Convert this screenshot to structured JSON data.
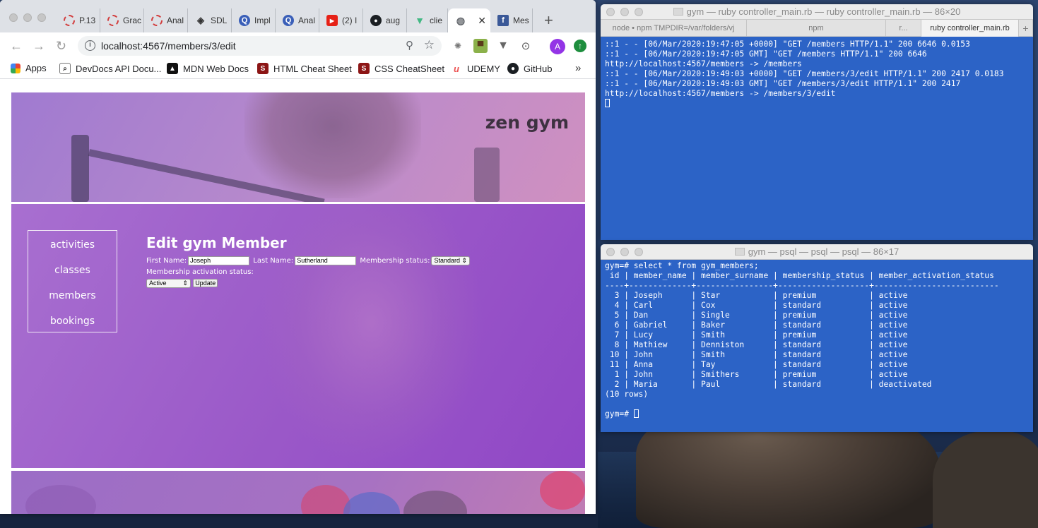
{
  "browser": {
    "tabs": [
      {
        "label": "P.13",
        "icon": "red-ring-icon"
      },
      {
        "label": "Grac",
        "icon": "red-ring-icon"
      },
      {
        "label": "Anal",
        "icon": "red-ring-icon"
      },
      {
        "label": "SDL",
        "icon": "diamond-icon"
      },
      {
        "label": "Impl",
        "icon": "q-icon"
      },
      {
        "label": "Anal",
        "icon": "q-icon"
      },
      {
        "label": "(2) I",
        "icon": "youtube-icon"
      },
      {
        "label": "aug",
        "icon": "github-icon"
      },
      {
        "label": "clie",
        "icon": "vue-icon"
      },
      {
        "label": "",
        "icon": "globe-icon"
      },
      {
        "label": "Mes",
        "icon": "facebook-icon"
      }
    ],
    "url_host": "localhost",
    "url_path": ":4567/members/3/edit",
    "avatar_letter": "A",
    "bookmarks": [
      {
        "label": "Apps"
      },
      {
        "label": "DevDocs API Docu..."
      },
      {
        "label": "MDN Web Docs"
      },
      {
        "label": "HTML Cheat Sheet"
      },
      {
        "label": "CSS CheatSheet"
      },
      {
        "label": "UDEMY"
      },
      {
        "label": "GitHub"
      }
    ]
  },
  "site": {
    "brand": "zen gym",
    "nav": [
      "activities",
      "classes",
      "members",
      "bookings"
    ],
    "form": {
      "title": "Edit gym Member",
      "first_name_label": "First Name:",
      "first_name_value": "Joseph",
      "last_name_label": "Last Name:",
      "last_name_value": "Sutherland",
      "membership_status_label": "Membership status:",
      "membership_status_value": "Standard",
      "activation_label": "Membership activation status:",
      "activation_value": "Active",
      "submit_label": "Update"
    }
  },
  "terminal_server": {
    "title": "gym — ruby controller_main.rb — ruby controller_main.rb — 86×20",
    "tabs": [
      "node • npm TMPDIR=/var/folders/vj",
      "npm",
      "r...",
      "ruby controller_main.rb"
    ],
    "lines": [
      "::1 - - [06/Mar/2020:19:47:05 +0000] \"GET /members HTTP/1.1\" 200 6646 0.0153",
      "::1 - - [06/Mar/2020:19:47:05 GMT] \"GET /members HTTP/1.1\" 200 6646",
      "http://localhost:4567/members -> /members",
      "::1 - - [06/Mar/2020:19:49:03 +0000] \"GET /members/3/edit HTTP/1.1\" 200 2417 0.0183",
      "::1 - - [06/Mar/2020:19:49:03 GMT] \"GET /members/3/edit HTTP/1.1\" 200 2417",
      "http://localhost:4567/members -> /members/3/edit"
    ]
  },
  "terminal_psql": {
    "title": "gym — psql — psql — psql — 86×17",
    "command": "gym=# select * from gym_members;",
    "header": " id | member_name | member_surname | membership_status | member_activation_status",
    "separator": "----+-------------+----------------+-------------------+--------------------------",
    "rows": [
      "  3 | Joseph      | Star           | premium           | active",
      "  4 | Carl        | Cox            | standard          | active",
      "  5 | Dan         | Single         | premium           | active",
      "  6 | Gabriel     | Baker          | standard          | active",
      "  7 | Lucy        | Smith          | premium           | active",
      "  8 | Mathiew     | Denniston      | standard          | active",
      " 10 | John        | Smith          | standard          | active",
      " 11 | Anna        | Tay            | standard          | active",
      "  1 | John        | Smithers       | premium           | active",
      "  2 | Maria       | Paul           | standard          | deactivated"
    ],
    "footer": "(10 rows)",
    "prompt": "gym=# "
  }
}
